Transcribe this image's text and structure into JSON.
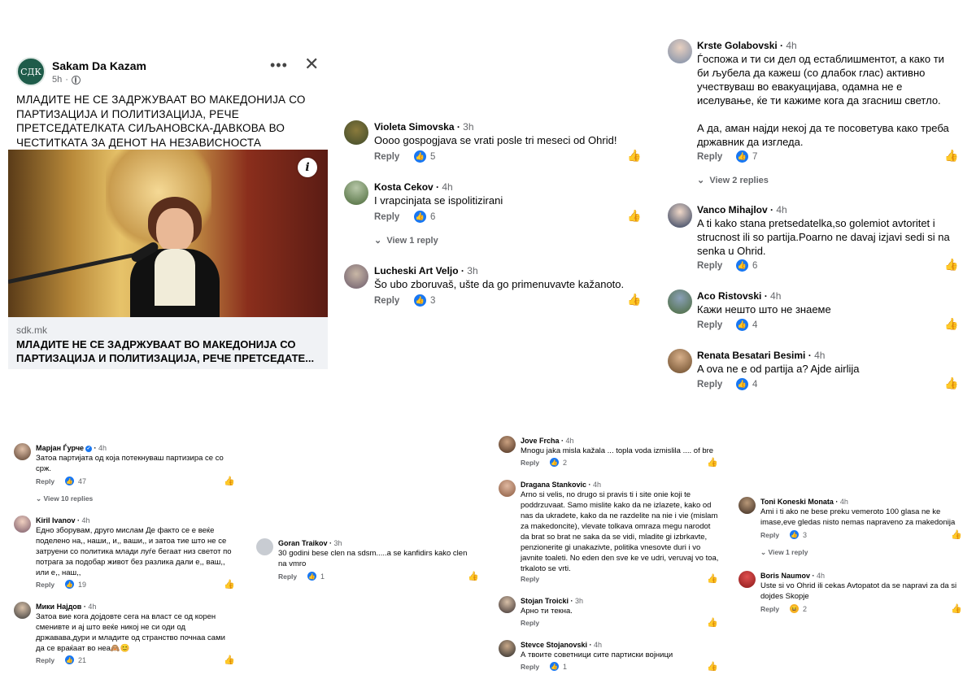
{
  "post": {
    "page_initials": "СДК",
    "page_name": "Sakam Da Kazam",
    "time": "5h",
    "more_label": "•••",
    "close_label": "✕",
    "text": "МЛАДИТЕ НЕ СЕ ЗАДРЖУВААТ ВО МАКЕДОНИЈА СО ПАРТИЗАЦИЈА И ПОЛИТИЗАЦИЈА, РЕЧЕ ПРЕТСЕДАТЕЛКАТА СИЉАНОВСКА-ДАВКОВА ВО ЧЕСТИТКАТА ЗА ДЕНОТ НА НЕЗАВИСНОСТА",
    "info_label": "i",
    "link_domain": "sdk.mk",
    "link_title": "МЛАДИТЕ НЕ СЕ ЗАДРЖУВААТ ВО МАКЕДОНИЈА СО ПАРТИЗАЦИЈА И ПОЛИТИЗАЦИЈА, РЕЧЕ ПРЕТСЕДАТЕ..."
  },
  "ui": {
    "reply_label": "Reply",
    "like_icon": "thumbs-up-icon",
    "accent_color": "#1877f2"
  },
  "comments_a": [
    {
      "name": "Violeta Simovska",
      "time": "3h",
      "text": "Oooo gospogjava se vrati posle tri meseci od Ohrid!",
      "likes": "5"
    },
    {
      "name": "Kosta Cekov",
      "time": "4h",
      "text": "I vrapcinjata se ispolitizirani",
      "likes": "6",
      "view_replies": "View 1 reply"
    },
    {
      "name": "Lucheski Art Veljo",
      "time": "3h",
      "text": "Šo ubo zboruvaš, ušte da go primenuvavte kažanoto.",
      "likes": "3"
    }
  ],
  "comments_b": [
    {
      "name": "Krste Golabovski",
      "time": "4h",
      "text1": "Ѓоспожа и ти си дел од естаблишментот, а како ти би љубела да кажеш (со длабок глас) активно учествуваш во евакуацијава, одамна не е иселување, ќе ти кажиме кога да згасниш светло.",
      "text2": "А да,  аман најди некој да те посоветува како треба државник да изгледа.",
      "likes": "7",
      "view_replies": "View 2 replies"
    },
    {
      "name": "Vanco Mihajlov",
      "time": "4h",
      "text": "A ti kako stana pretsedatelka,so golemiot avtoritet i strucnost ili so partija.Poarno ne davaj izjavi sedi si na senka u Ohrid.",
      "likes": "6"
    },
    {
      "name": "Aco Ristovski",
      "time": "4h",
      "text": "Кажи нешто што не знаеме",
      "likes": "4"
    },
    {
      "name": "Renata Besatari Besimi",
      "time": "4h",
      "text": "A ova ne e od partija a? Ajde airlija",
      "likes": "4"
    }
  ],
  "comments_c": [
    {
      "name": "Марјан Ѓурче",
      "time": "4h",
      "verified": true,
      "text": "Затоа партијата од која потекнуваш партизира се со срж.",
      "likes": "47",
      "view_replies": "View 10 replies"
    },
    {
      "name": "Kiril Ivanov",
      "time": "4h",
      "text": "Едно зборувам, друго мислам Де факто се е веќе поделено на,, наши,, и,, ваши,, и затоа тие што не се затруени со политика млади луѓе бегаат низ светот по потрага за подобар живот без разлика дали е,, ваш,, или е,, наш,,",
      "likes": "19"
    },
    {
      "name": "Мики Најдов",
      "time": "4h",
      "text": "Затоа вие кога дојдовте сега на власт се од корен сменивте и ај што веќе никој не си оди од државава,дури и младите од странство почнаа сами да се враќаат во неа🙈😊",
      "likes": "21"
    }
  ],
  "comments_d": [
    {
      "name": "Goran Traikov",
      "time": "3h",
      "text": "30 godini bese clen na sdsm.....a se kanfidirs kako clen na vmro",
      "likes": "1"
    }
  ],
  "comments_e": [
    {
      "name": "Jove Frcha",
      "time": "4h",
      "text": "Mnogu jaka misla kažala ... topla voda izmislila .... of bre",
      "likes": "2"
    },
    {
      "name": "Dragana Stankovic",
      "time": "4h",
      "text": "Arno si velis, no drugo si pravis ti i site onie koji te poddrzuvaat. Samo mislite kako da ne izlazete, kako od nas da ukradete, kako da ne razdelite na nie i vie (mislam za makedoncite), vlevate tolkava omraza megu narodot da brat so brat ne saka da se vidi, mladite gi izbrkavte, penzionerite gi unakazivte, politika vnesovte duri i vo javnite toaleti. No eden den sve ke ve udri, veruvaj vo toa, trkaloto se vrti.",
      "likes": ""
    },
    {
      "name": "Stojan Troicki",
      "time": "3h",
      "text": "Арно ти текна.",
      "likes": ""
    },
    {
      "name": "Stevce Stojanovski",
      "time": "4h",
      "text": "А твоите советници сите партиски војници",
      "likes": "1"
    }
  ],
  "comments_f": [
    {
      "name": "Toni Koneski Monata",
      "time": "4h",
      "text": "Ami i ti ako ne bese preku vemeroto 100 glasa ne ke imase,eve gledas nisto nemas napraveno za makedonija",
      "likes": "3",
      "view_replies": "View 1 reply"
    },
    {
      "name": "Boris Naumov",
      "time": "4h",
      "text": "Uste si vo Ohrid ili cekas Avtopatot da se napravi za da si dojdes Skopje",
      "likes": "2",
      "reaction": "haha"
    }
  ]
}
